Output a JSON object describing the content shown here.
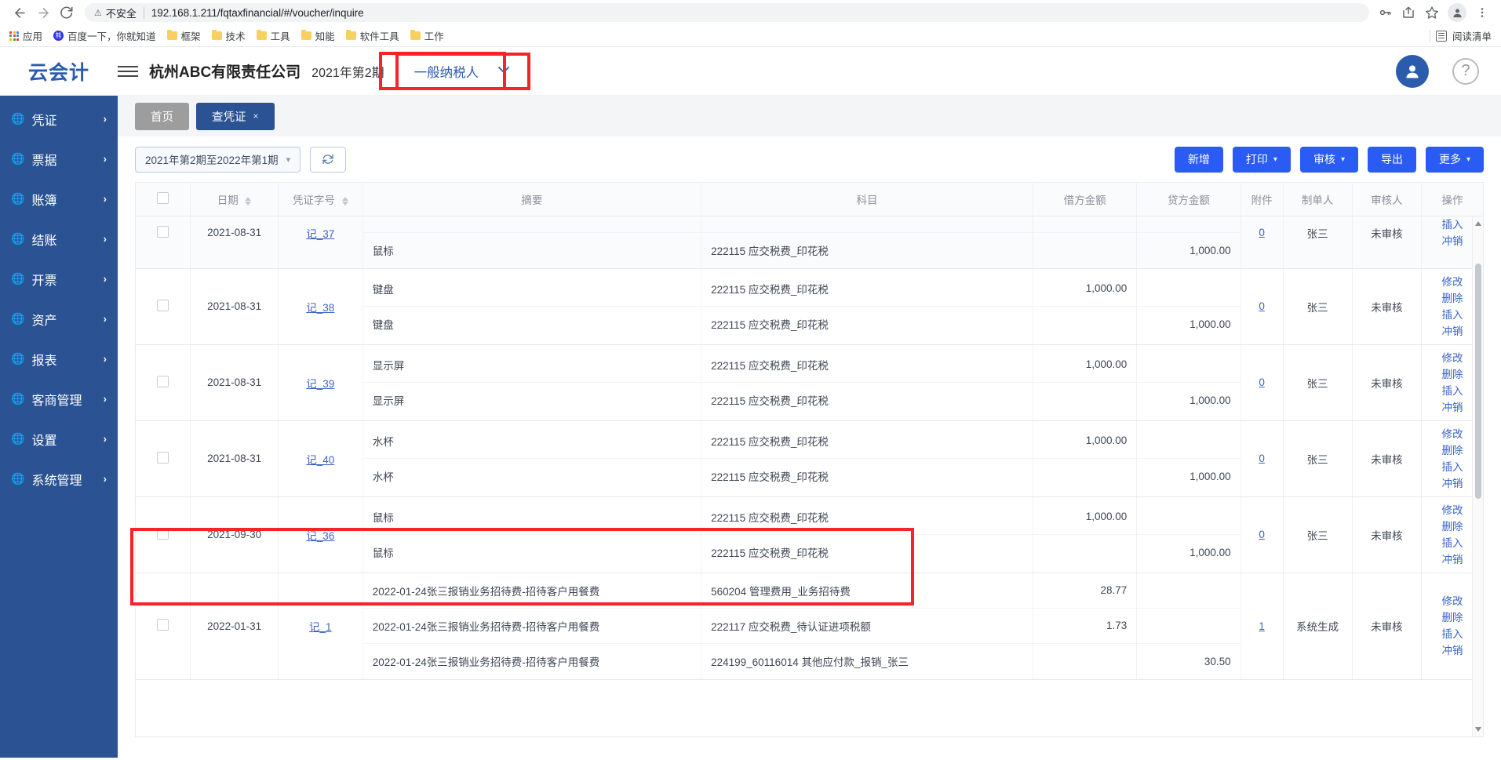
{
  "browser": {
    "back_icon": "back-arrow-icon",
    "forward_icon": "forward-arrow-icon",
    "reload_icon": "reload-icon",
    "security_label": "不安全",
    "url": "192.168.1.211/fqtaxfinancial/#/voucher/inquire",
    "bookmarks": [
      {
        "label": "应用",
        "icon": "apps-grid-icon"
      },
      {
        "label": "百度一下，你就知道",
        "icon": "baidu-icon"
      },
      {
        "label": "框架",
        "icon": "folder-icon"
      },
      {
        "label": "技术",
        "icon": "folder-icon"
      },
      {
        "label": "工具",
        "icon": "folder-icon"
      },
      {
        "label": "知能",
        "icon": "folder-icon"
      },
      {
        "label": "软件工具",
        "icon": "folder-icon"
      },
      {
        "label": "工作",
        "icon": "folder-icon"
      }
    ],
    "reading_list": "阅读清单"
  },
  "header": {
    "logo": "云会计",
    "company": "杭州ABC有限责任公司",
    "period": "2021年第2期",
    "taxpayer_type": "一般纳税人",
    "menu_icon": "hamburger-icon",
    "user_icon": "user-avatar-icon",
    "help_icon": "help-question-icon"
  },
  "sidebar": {
    "items": [
      {
        "label": "凭证"
      },
      {
        "label": "票据"
      },
      {
        "label": "账簿"
      },
      {
        "label": "结账"
      },
      {
        "label": "开票"
      },
      {
        "label": "资产"
      },
      {
        "label": "报表"
      },
      {
        "label": "客商管理"
      },
      {
        "label": "设置"
      },
      {
        "label": "系统管理"
      }
    ]
  },
  "tabs": [
    {
      "label": "首页",
      "closable": false,
      "active": false
    },
    {
      "label": "查凭证",
      "closable": true,
      "active": true,
      "close": "×"
    }
  ],
  "toolbar": {
    "range_value": "2021年第2期至2022年第1期",
    "refresh_icon": "refresh-icon",
    "buttons": [
      {
        "label": "新增",
        "caret": false
      },
      {
        "label": "打印",
        "caret": true
      },
      {
        "label": "审核",
        "caret": true
      },
      {
        "label": "导出",
        "caret": false
      },
      {
        "label": "更多",
        "caret": true
      }
    ]
  },
  "table": {
    "columns": [
      {
        "key": "check",
        "label": "",
        "sortable": false
      },
      {
        "key": "date",
        "label": "日期",
        "sortable": true
      },
      {
        "key": "voucher_no",
        "label": "凭证字号",
        "sortable": true
      },
      {
        "key": "summary",
        "label": "摘要",
        "sortable": false
      },
      {
        "key": "subject",
        "label": "科目",
        "sortable": false
      },
      {
        "key": "debit",
        "label": "借方金额",
        "sortable": false
      },
      {
        "key": "credit",
        "label": "贷方金额",
        "sortable": false
      },
      {
        "key": "attachment",
        "label": "附件",
        "sortable": false
      },
      {
        "key": "maker",
        "label": "制单人",
        "sortable": false
      },
      {
        "key": "auditor",
        "label": "审核人",
        "sortable": false
      },
      {
        "key": "actions",
        "label": "操作",
        "sortable": false
      }
    ],
    "rows": [
      {
        "date": "2021-08-31",
        "voucher_no": "记_37",
        "attachment": "0",
        "maker": "张三",
        "auditor": "未审核",
        "partial_top": true,
        "shaded": true,
        "lines": [
          {
            "summary": "",
            "subject": "",
            "debit": "",
            "credit": ""
          },
          {
            "summary": "鼠标",
            "subject": "222115 应交税费_印花税",
            "debit": "",
            "credit": "1,000.00"
          }
        ],
        "actions": [
          "插入",
          "冲销"
        ]
      },
      {
        "date": "2021-08-31",
        "voucher_no": "记_38",
        "attachment": "0",
        "maker": "张三",
        "auditor": "未审核",
        "lines": [
          {
            "summary": "键盘",
            "subject": "222115 应交税费_印花税",
            "debit": "1,000.00",
            "credit": ""
          },
          {
            "summary": "键盘",
            "subject": "222115 应交税费_印花税",
            "debit": "",
            "credit": "1,000.00"
          }
        ],
        "actions": [
          "修改",
          "删除",
          "插入",
          "冲销"
        ]
      },
      {
        "date": "2021-08-31",
        "voucher_no": "记_39",
        "attachment": "0",
        "maker": "张三",
        "auditor": "未审核",
        "lines": [
          {
            "summary": "显示屏",
            "subject": "222115 应交税费_印花税",
            "debit": "1,000.00",
            "credit": ""
          },
          {
            "summary": "显示屏",
            "subject": "222115 应交税费_印花税",
            "debit": "",
            "credit": "1,000.00"
          }
        ],
        "actions": [
          "修改",
          "删除",
          "插入",
          "冲销"
        ]
      },
      {
        "date": "2021-08-31",
        "voucher_no": "记_40",
        "attachment": "0",
        "maker": "张三",
        "auditor": "未审核",
        "lines": [
          {
            "summary": "水杯",
            "subject": "222115 应交税费_印花税",
            "debit": "1,000.00",
            "credit": ""
          },
          {
            "summary": "水杯",
            "subject": "222115 应交税费_印花税",
            "debit": "",
            "credit": "1,000.00"
          }
        ],
        "actions": [
          "修改",
          "删除",
          "插入",
          "冲销"
        ]
      },
      {
        "date": "2021-09-30",
        "voucher_no": "记_36",
        "attachment": "0",
        "maker": "张三",
        "auditor": "未审核",
        "lines": [
          {
            "summary": "鼠标",
            "subject": "222115 应交税费_印花税",
            "debit": "1,000.00",
            "credit": ""
          },
          {
            "summary": "鼠标",
            "subject": "222115 应交税费_印花税",
            "debit": "",
            "credit": "1,000.00"
          }
        ],
        "actions": [
          "修改",
          "删除",
          "插入",
          "冲销"
        ]
      },
      {
        "date": "2022-01-31",
        "voucher_no": "记_1",
        "attachment": "1",
        "maker": "系统生成",
        "auditor": "未审核",
        "highlighted": true,
        "lines": [
          {
            "summary": "2022-01-24张三报销业务招待费-招待客户用餐费",
            "subject": "560204 管理费用_业务招待费",
            "debit": "28.77",
            "credit": ""
          },
          {
            "summary": "2022-01-24张三报销业务招待费-招待客户用餐费",
            "subject": "222117 应交税费_待认证进项税额",
            "debit": "1.73",
            "credit": ""
          },
          {
            "summary": "2022-01-24张三报销业务招待费-招待客户用餐费",
            "subject": "224199_60116014 其他应付款_报销_张三",
            "debit": "",
            "credit": "30.50"
          }
        ],
        "actions": [
          "修改",
          "删除",
          "插入",
          "冲销"
        ]
      }
    ]
  },
  "annotations": {
    "taxpayer_highlight_color": "#f5232a",
    "row_highlight_color": "#f5232a"
  }
}
